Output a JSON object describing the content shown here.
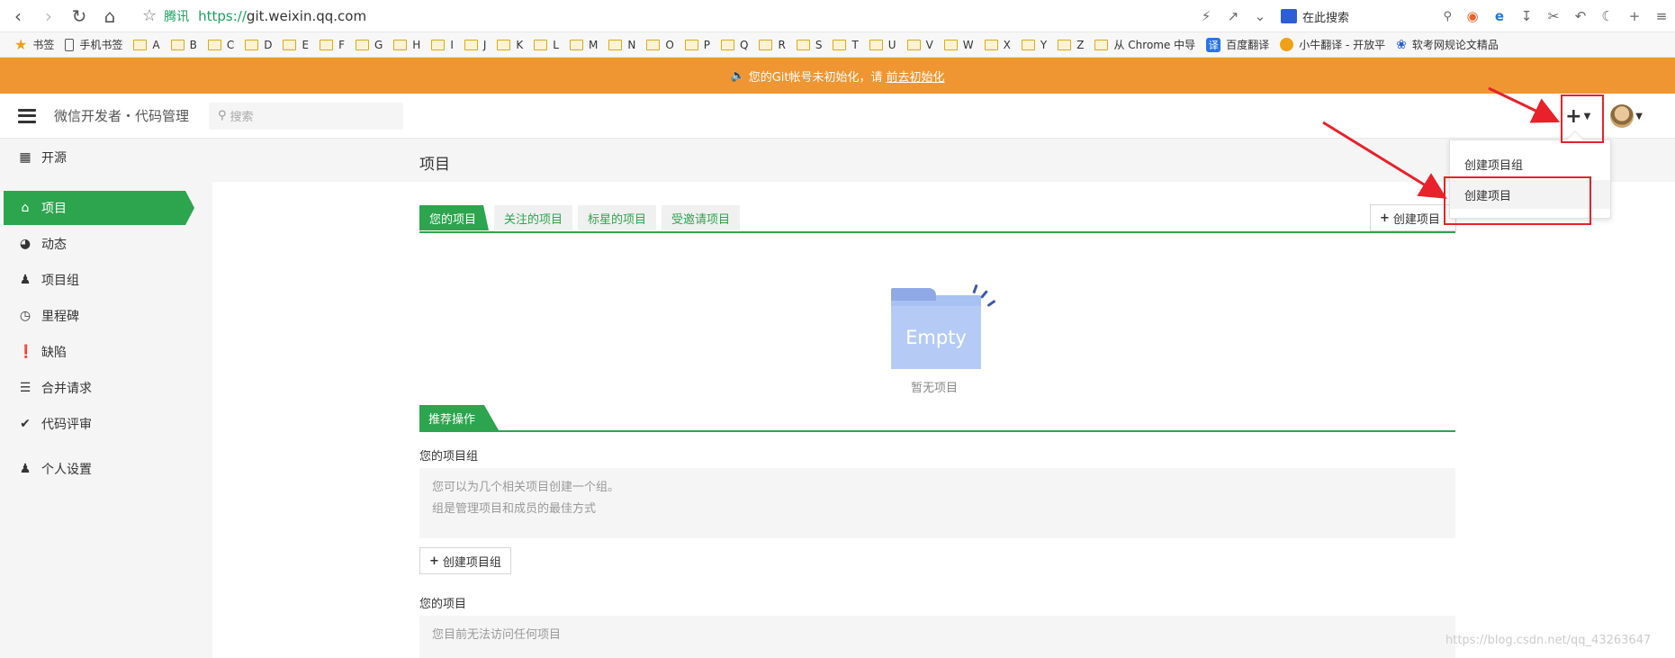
{
  "browser": {
    "site_name": "腾讯",
    "url_scheme": "https://",
    "url_host": "git.weixin.qq.com",
    "search_placeholder": "在此搜索"
  },
  "bookmarks": [
    {
      "label": "书签",
      "icon": "star-icon"
    },
    {
      "label": "手机书签",
      "icon": "phone-icon"
    },
    {
      "label": "A",
      "icon": "folder-icon"
    },
    {
      "label": "B",
      "icon": "folder-icon"
    },
    {
      "label": "C",
      "icon": "folder-icon"
    },
    {
      "label": "D",
      "icon": "folder-icon"
    },
    {
      "label": "E",
      "icon": "folder-icon"
    },
    {
      "label": "F",
      "icon": "folder-icon"
    },
    {
      "label": "G",
      "icon": "folder-icon"
    },
    {
      "label": "H",
      "icon": "folder-icon"
    },
    {
      "label": "I",
      "icon": "folder-icon"
    },
    {
      "label": "J",
      "icon": "folder-icon"
    },
    {
      "label": "K",
      "icon": "folder-icon"
    },
    {
      "label": "L",
      "icon": "folder-icon"
    },
    {
      "label": "M",
      "icon": "folder-icon"
    },
    {
      "label": "N",
      "icon": "folder-icon"
    },
    {
      "label": "O",
      "icon": "folder-icon"
    },
    {
      "label": "P",
      "icon": "folder-icon"
    },
    {
      "label": "Q",
      "icon": "folder-icon"
    },
    {
      "label": "R",
      "icon": "folder-icon"
    },
    {
      "label": "S",
      "icon": "folder-icon"
    },
    {
      "label": "T",
      "icon": "folder-icon"
    },
    {
      "label": "U",
      "icon": "folder-icon"
    },
    {
      "label": "V",
      "icon": "folder-icon"
    },
    {
      "label": "W",
      "icon": "folder-icon"
    },
    {
      "label": "X",
      "icon": "folder-icon"
    },
    {
      "label": "Y",
      "icon": "folder-icon"
    },
    {
      "label": "Z",
      "icon": "folder-icon"
    },
    {
      "label": "从 Chrome 中导",
      "icon": "folder-icon"
    },
    {
      "label": "百度翻译",
      "icon": "translate-icon"
    },
    {
      "label": "小牛翻译 - 开放平",
      "icon": "niu-icon"
    },
    {
      "label": "软考网规论文精品",
      "icon": "paw-icon"
    }
  ],
  "notice": {
    "text": "您的Git帐号未初始化，请",
    "link": "前去初始化"
  },
  "header": {
    "brand": "微信开发者・代码管理",
    "search_placeholder": "搜索"
  },
  "sidebar": {
    "items": [
      {
        "label": "开源",
        "icon": "map-icon"
      },
      {
        "label": "项目",
        "icon": "home-icon",
        "active": true
      },
      {
        "label": "动态",
        "icon": "dashboard-icon"
      },
      {
        "label": "项目组",
        "icon": "users-icon"
      },
      {
        "label": "里程碑",
        "icon": "clock-icon"
      },
      {
        "label": "缺陷",
        "icon": "alert-circle-icon"
      },
      {
        "label": "合并请求",
        "icon": "merge-list-icon"
      },
      {
        "label": "代码评审",
        "icon": "check-circle-icon"
      },
      {
        "label": "个人设置",
        "icon": "user-icon"
      }
    ]
  },
  "main": {
    "title": "项目",
    "tabs": [
      "您的项目",
      "关注的项目",
      "标星的项目",
      "受邀请项目"
    ],
    "create_project_button": "创建项目",
    "empty_label": "Empty",
    "empty_text": "暂无项目",
    "recommended_tab": "推荐操作",
    "group_section_label": "您的项目组",
    "group_info_line1": "您可以为几个相关项目创建一个组。",
    "group_info_line2": "组是管理项目和成员的最佳方式",
    "create_group_button": "创建项目组",
    "project_section_label": "您的项目",
    "project_info": "您目前无法访问任何项目"
  },
  "dropdown": {
    "items": [
      "创建项目组",
      "创建项目"
    ]
  },
  "watermark": "https://blog.csdn.net/qq_43263647",
  "colors": {
    "accent_green": "#2da44e",
    "notice_orange": "#ef9632",
    "annotation_red": "#e8212a"
  }
}
